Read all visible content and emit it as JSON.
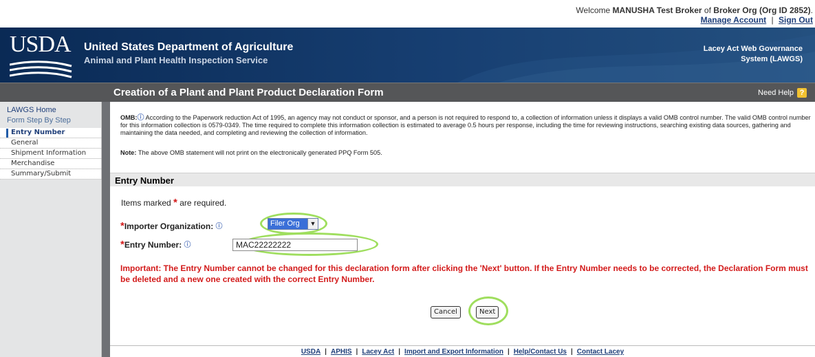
{
  "top": {
    "welcome_prefix": "Welcome",
    "user_name": "MANUSHA Test Broker",
    "of": "of",
    "org": "Broker Org (Org ID 2852)",
    "period": ".",
    "manage_account": "Manage Account",
    "separator": "|",
    "sign_out": "Sign Out"
  },
  "header": {
    "logo_text": "USDA",
    "agency_line1": "United States Department of Agriculture",
    "agency_line2": "Animal and Plant Health Inspection Service",
    "system_line1": "Lacey Act Web Governance",
    "system_line2": "System (LAWGS)"
  },
  "titlebar": {
    "title": "Creation of a Plant and Plant Product Declaration Form",
    "help": "Need Help",
    "help_icon": "?"
  },
  "sidebar": {
    "home": "LAWGS Home",
    "step_header": "Form Step By Step",
    "items": [
      {
        "label": "Entry Number"
      },
      {
        "label": "General"
      },
      {
        "label": "Shipment Information"
      },
      {
        "label": "Merchandise"
      },
      {
        "label": "Summary/Submit"
      }
    ]
  },
  "main": {
    "omb_label": "OMB:",
    "omb_text": "According to the Paperwork reduction Act of 1995, an agency may not conduct or sponsor, and a person is not required to respond to, a collection of information unless it displays a valid OMB control number. The valid OMB control number for this information collection is 0579-0349. The time required to complete this information collection is estimated to average 0.5 hours per response, including the time for reviewing instructions, searching existing data sources, gathering and maintaining the data needed, and completing and reviewing the collection of information.",
    "note_label": "Note:",
    "note_text": "The above OMB statement will not print on the electronically generated PPQ Form 505.",
    "section_title": "Entry Number",
    "required_prefix": "Items marked",
    "required_star": "*",
    "required_suffix": "are required.",
    "importer_label": "Importer Organization:",
    "importer_value": "Filer Org",
    "entry_label": "Entry Number:",
    "entry_value": "MAC22222222",
    "important": "Important:  The Entry Number cannot be changed for this declaration form after clicking the 'Next' button. If the Entry Number needs to be corrected, the Declaration Form must be deleted and a new one created with the correct Entry Number.",
    "cancel_label": "Cancel",
    "next_label": "Next"
  },
  "footer": {
    "links": [
      "USDA",
      "APHIS",
      "Lacey Act",
      "Import and Export Information",
      "Help/Contact Us",
      "Contact Lacey"
    ],
    "separator": "|"
  },
  "colors": {
    "banner": "#173f72",
    "titlebar": "#555658",
    "highlight_ring": "#9fde5e",
    "important_text": "#d31b1b",
    "link": "#1f3f7a"
  }
}
